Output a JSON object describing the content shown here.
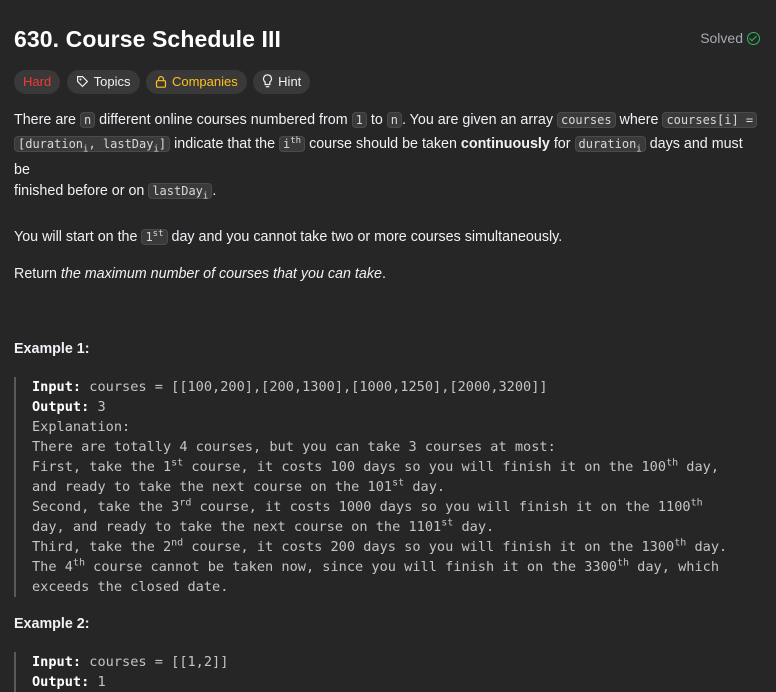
{
  "problem": {
    "title": "630. Course Schedule III",
    "status": "Solved"
  },
  "tags": [
    {
      "label": "Hard",
      "icon": ""
    },
    {
      "label": "Topics",
      "icon": "tag-icon"
    },
    {
      "label": "Companies",
      "icon": "lock-icon"
    },
    {
      "label": "Hint",
      "icon": "lightbulb-icon"
    }
  ],
  "colors": {
    "background": "#262626",
    "hard": "#f63737",
    "companies": "#ffc01e",
    "solved_check": "#2cbb5d"
  },
  "description": {
    "p1": {
      "t1": "There are ",
      "c1": "n",
      "t2": " different online courses numbered from ",
      "c2": "1",
      "t3": " to ",
      "c3": "n",
      "t4": ". You are given an array ",
      "c4": "courses",
      "t5": " where ",
      "c5": "courses[i] =",
      "c6a": "[duration",
      "c6sub1": "i",
      "c6b": ", lastDay",
      "c6sub2": "i",
      "c6c": "]",
      "t6": " indicate that the ",
      "c7a": "i",
      "c7sup": "th",
      "t7": " course should be taken ",
      "bold": "continuously",
      "t8": " for ",
      "c8a": "duration",
      "c8sub": "i",
      "t9": " days and must be",
      "t10": "finished before or on ",
      "c9a": "lastDay",
      "c9sub": "i",
      "t11": "."
    },
    "p2": {
      "t1": "You will start on the ",
      "c1a": "1",
      "c1sup": "st",
      "t2": " day and you cannot take two or more courses simultaneously."
    },
    "p3": {
      "t1": "Return ",
      "em": "the maximum number of courses that you can take",
      "t2": "."
    }
  },
  "example1": {
    "title": "Example 1:",
    "input_label": "Input:",
    "input_value": " courses = [[100,200],[200,1300],[1000,1250],[2000,3200]]",
    "output_label": "Output:",
    "output_value": " 3",
    "explanation_label": "Explanation:",
    "l1": "There are totally 4 courses, but you can take 3 courses at most:",
    "l2a": "First, take the 1",
    "l2sup": "st",
    "l2b": " course, it costs 100 days so you will finish it on the 100",
    "l2sup2": "th",
    "l2c": " day,",
    "l3a": "and ready to take the next course on the 101",
    "l3sup": "st",
    "l3b": " day.",
    "l4a": "Second, take the 3",
    "l4sup": "rd",
    "l4b": " course, it costs 1000 days so you will finish it on the 1100",
    "l4sup2": "th",
    "l5a": "day, and ready to take the next course on the 1101",
    "l5sup": "st",
    "l5b": " day.",
    "l6a": "Third, take the 2",
    "l6sup": "nd",
    "l6b": " course, it costs 200 days so you will finish it on the 1300",
    "l6sup2": "th",
    "l6c": " day.",
    "l7a": "The 4",
    "l7sup": "th",
    "l7b": " course cannot be taken now, since you will finish it on the 3300",
    "l7sup2": "th",
    "l7c": " day, which",
    "l8": "exceeds the closed date."
  },
  "example2": {
    "title": "Example 2:",
    "input_label": "Input:",
    "input_value": " courses = [[1,2]]",
    "output_label": "Output:",
    "output_value": " 1"
  }
}
